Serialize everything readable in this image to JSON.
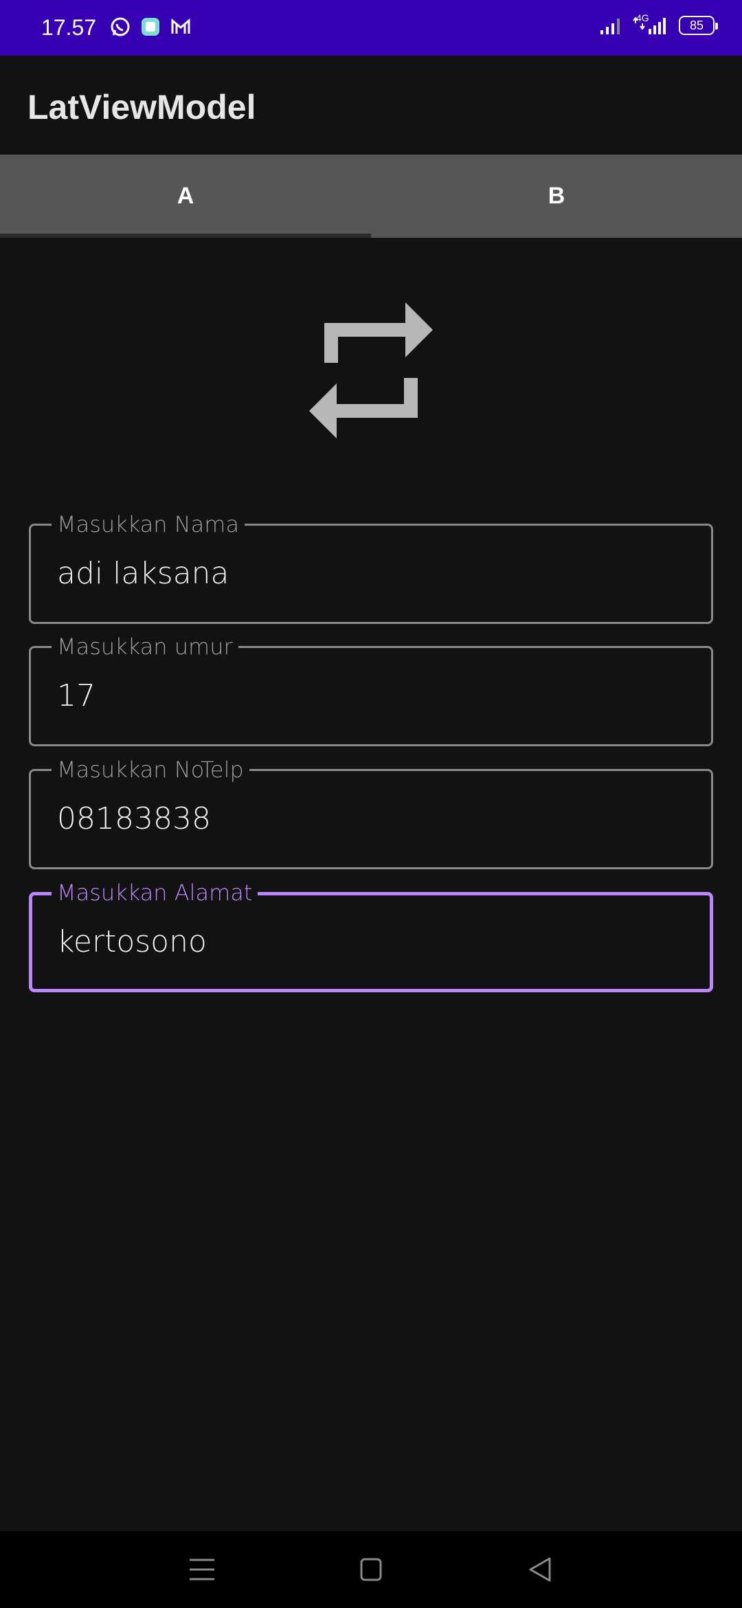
{
  "status_bar": {
    "time": "17.57",
    "network": "4G",
    "battery": "85",
    "notification_icons": [
      "whatsapp-icon",
      "app-icon",
      "gmail-icon"
    ],
    "background_color": "#3700b3"
  },
  "app_bar": {
    "title": "LatViewModel"
  },
  "tabs": [
    {
      "label": "A",
      "selected": true
    },
    {
      "label": "B",
      "selected": false
    }
  ],
  "main": {
    "icon": "swap-arrows-icon",
    "fields": [
      {
        "label": "Masukkan Nama",
        "value": "adi laksana",
        "focused": false
      },
      {
        "label": "Masukkan umur",
        "value": "17",
        "focused": false
      },
      {
        "label": "Masukkan NoTelp",
        "value": "08183838",
        "focused": false
      },
      {
        "label": "Masukkan Alamat",
        "value": "kertosono",
        "focused": true
      }
    ],
    "accent_color": "#bb86fc"
  },
  "nav_bar": {
    "buttons": [
      "menu-icon",
      "home-icon",
      "back-icon"
    ]
  }
}
